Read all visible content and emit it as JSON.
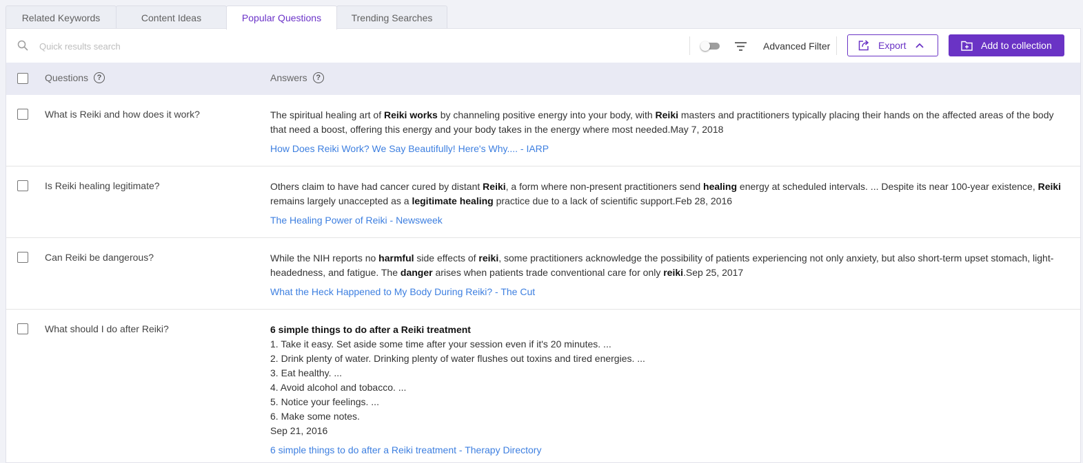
{
  "tabs": [
    {
      "label": "Related Keywords",
      "active": false
    },
    {
      "label": "Content Ideas",
      "active": false
    },
    {
      "label": "Popular Questions",
      "active": true
    },
    {
      "label": "Trending Searches",
      "active": false
    }
  ],
  "toolbar": {
    "search_placeholder": "Quick results search",
    "toggle_on": false,
    "advanced_filter_label": "Advanced Filter",
    "export_label": "Export",
    "add_collection_label": "Add to collection"
  },
  "table": {
    "headers": {
      "questions": "Questions",
      "answers": "Answers"
    },
    "rows": [
      {
        "question": "What is Reiki and how does it work?",
        "answer": [
          {
            "t": "The spiritual healing art of "
          },
          {
            "t": "Reiki works",
            "b": true
          },
          {
            "t": " by channeling positive energy into your body, with "
          },
          {
            "t": "Reiki",
            "b": true
          },
          {
            "t": " masters and practitioners typically placing their hands on the affected areas of the body that need a boost, offering this energy and your body takes in the energy where most needed.May 7, 2018"
          }
        ],
        "source": "How Does Reiki Work? We Say Beautifully! Here's Why.... - IARP"
      },
      {
        "question": "Is Reiki healing legitimate?",
        "answer": [
          {
            "t": "Others claim to have had cancer cured by distant "
          },
          {
            "t": "Reiki",
            "b": true
          },
          {
            "t": ", a form where non-present practitioners send "
          },
          {
            "t": "healing",
            "b": true
          },
          {
            "t": " energy at scheduled intervals. ... Despite its near 100-year existence, "
          },
          {
            "t": "Reiki",
            "b": true
          },
          {
            "t": " remains largely unaccepted as a "
          },
          {
            "t": "legitimate healing",
            "b": true
          },
          {
            "t": " practice due to a lack of scientific support.Feb 28, 2016"
          }
        ],
        "source": "The Healing Power of Reiki - Newsweek"
      },
      {
        "question": "Can Reiki be dangerous?",
        "answer": [
          {
            "t": "While the NIH reports no "
          },
          {
            "t": "harmful",
            "b": true
          },
          {
            "t": " side effects of "
          },
          {
            "t": "reiki",
            "b": true
          },
          {
            "t": ", some practitioners acknowledge the possibility of patients experiencing not only anxiety, but also short-term upset stomach, light-headedness, and fatigue. The "
          },
          {
            "t": "danger",
            "b": true
          },
          {
            "t": " arises when patients trade conventional care for only "
          },
          {
            "t": "reiki",
            "b": true
          },
          {
            "t": ".Sep 25, 2017"
          }
        ],
        "source": "What the Heck Happened to My Body During Reiki? - The Cut"
      },
      {
        "question": "What should I do after Reiki?",
        "list_title": "6 simple things to do after a Reiki treatment",
        "list": [
          "1. Take it easy. Set aside some time after your session even if it's 20 minutes. ...",
          "2. Drink plenty of water. Drinking plenty of water flushes out toxins and tired energies. ...",
          "3. Eat healthy. ...",
          "4. Avoid alcohol and tobacco. ...",
          "5. Notice your feelings. ...",
          "6. Make some notes."
        ],
        "date": "Sep 21, 2016",
        "source": "6 simple things to do after a Reiki treatment - Therapy Directory"
      }
    ]
  },
  "colors": {
    "accent": "#6a33c5",
    "link": "#3d7fe0",
    "header_bg": "#e9eaf4"
  }
}
